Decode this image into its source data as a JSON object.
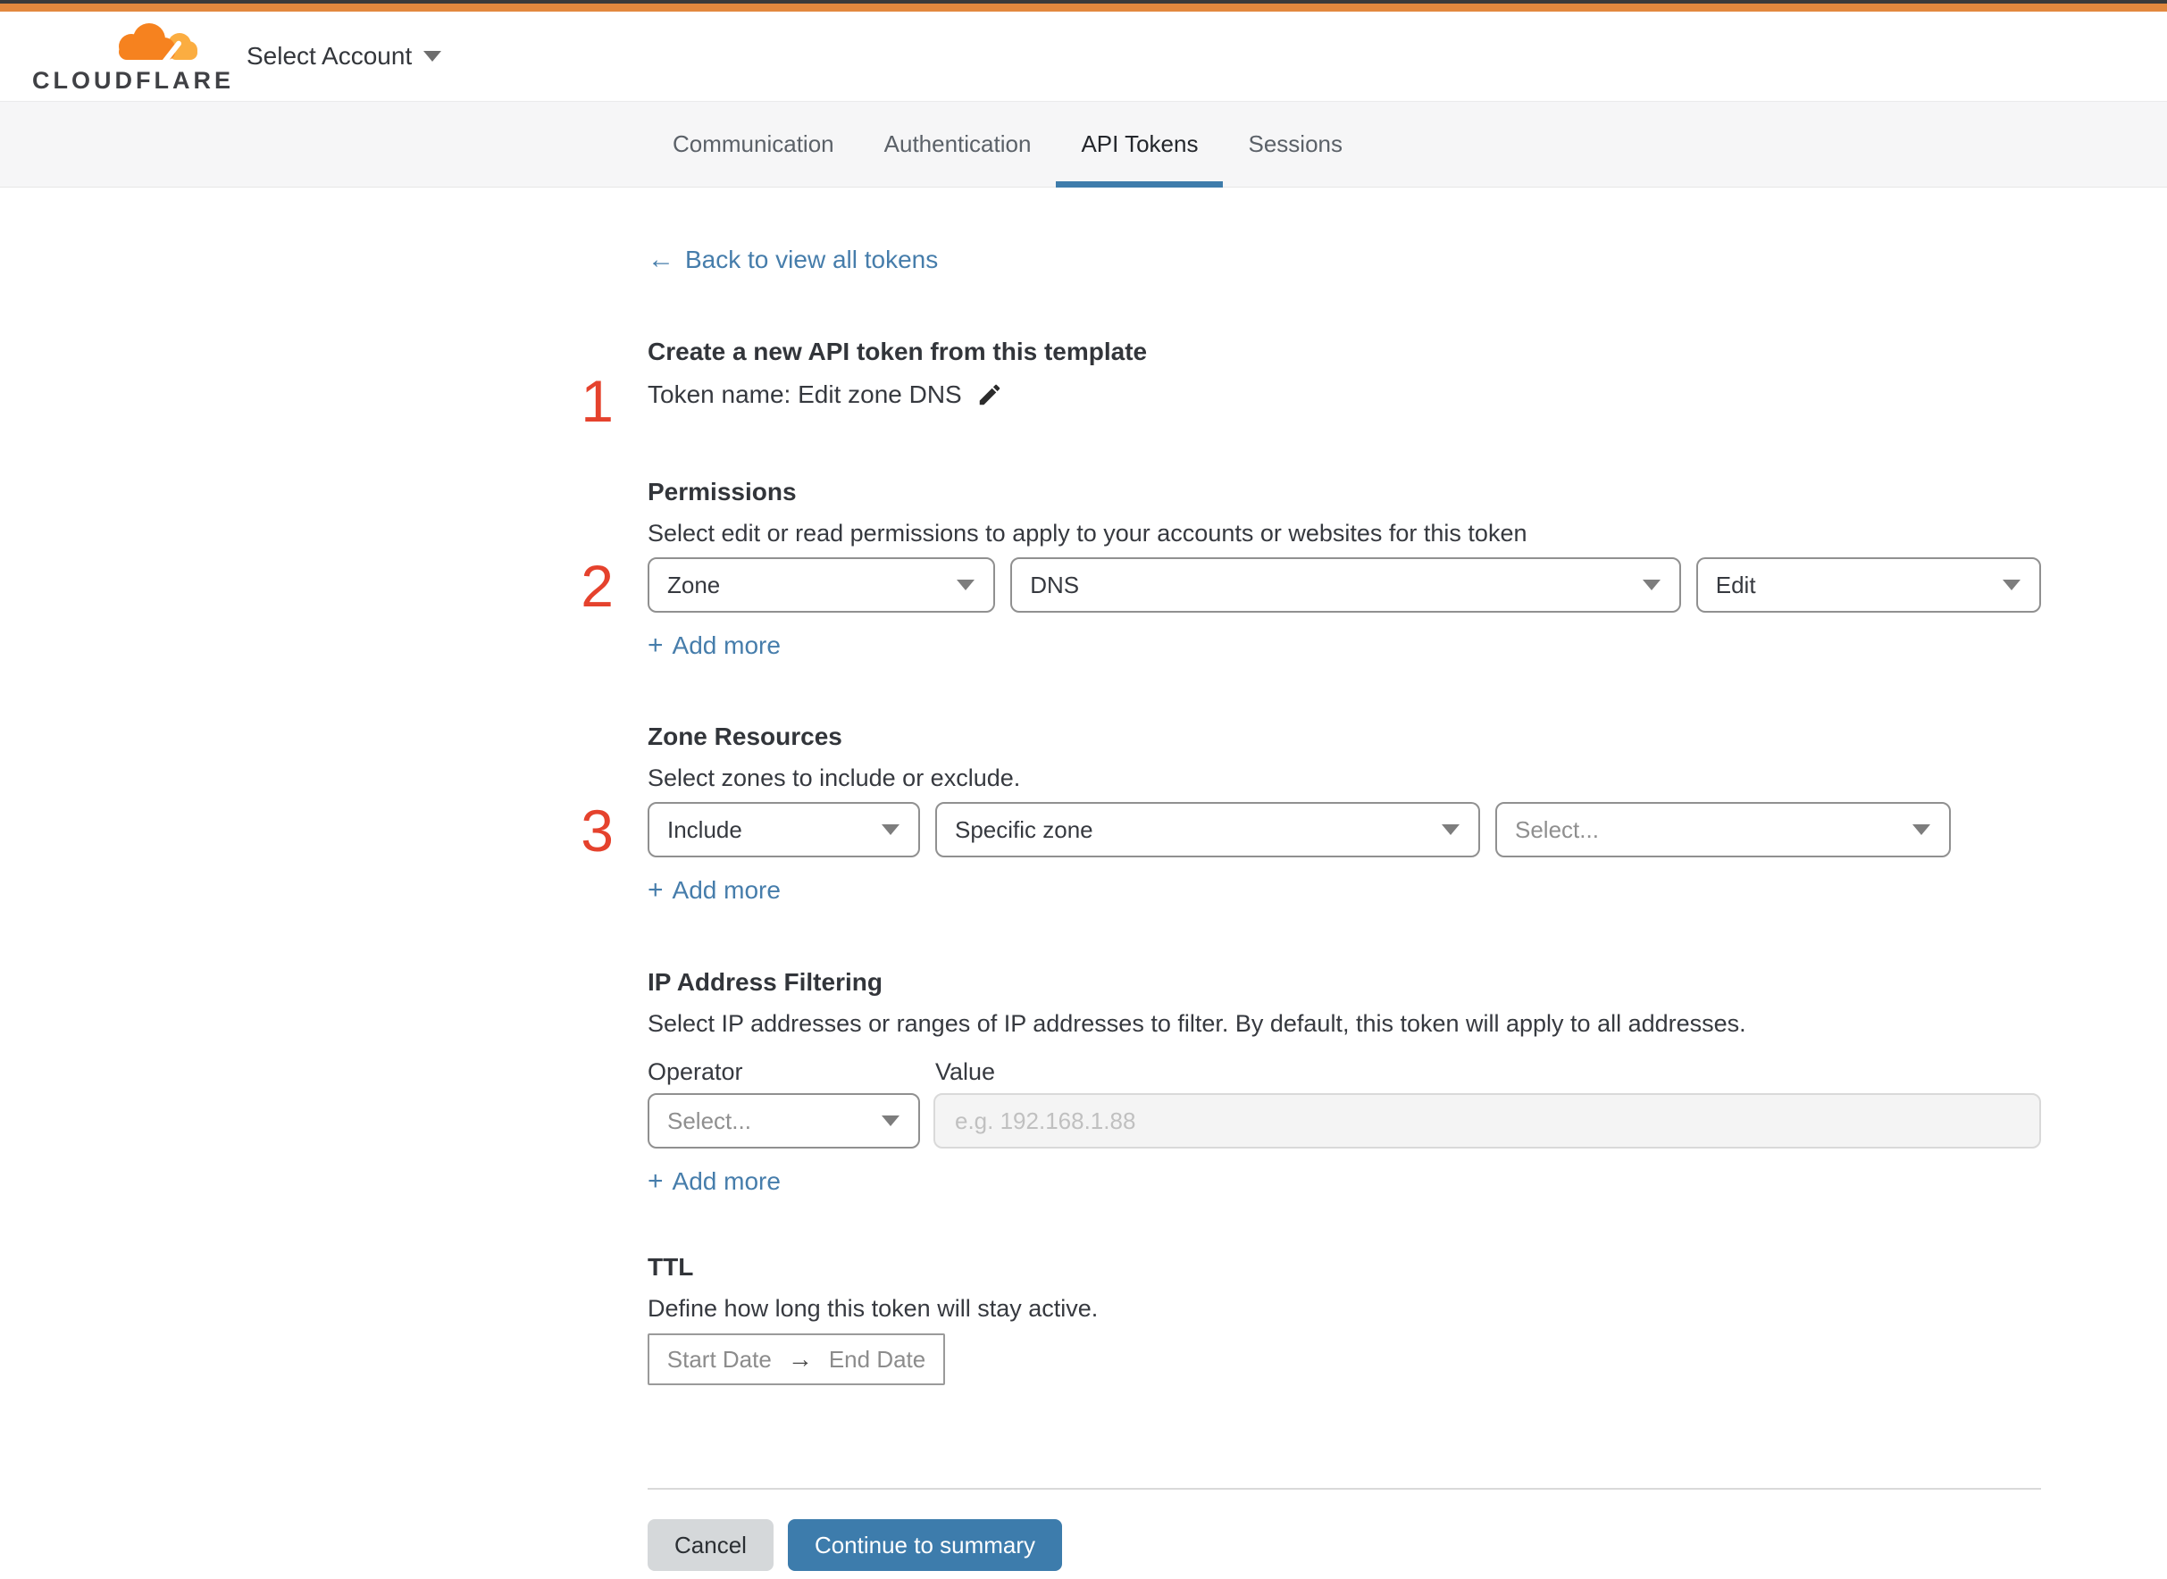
{
  "header": {
    "logo": "CLOUDFLARE",
    "account_selector": "Select Account"
  },
  "tabs": [
    {
      "label": "Communication"
    },
    {
      "label": "Authentication"
    },
    {
      "label": "API Tokens"
    },
    {
      "label": "Sessions"
    }
  ],
  "icons": {
    "back_arrow": "←",
    "plus": "+",
    "ttl_arrow": "→",
    "caret": "chevron-down",
    "pencil": "edit-pencil"
  },
  "colors": {
    "brand_orange": "#f6821f",
    "brand_orange_light": "#fbad41",
    "accent_blue": "#3d7cac",
    "marker_red": "#e5422d"
  },
  "content": {
    "back_label": "Back to view all tokens",
    "intro": {
      "marker": "1",
      "title": "Create a new API token from this template",
      "token_line": "Token name: Edit zone DNS"
    },
    "permissions": {
      "marker": "2",
      "title": "Permissions",
      "description": "Select edit or read permissions to apply to your accounts or websites for this token",
      "selects": [
        {
          "value": "Zone"
        },
        {
          "value": "DNS"
        },
        {
          "value": "Edit"
        }
      ],
      "add_more": "Add more"
    },
    "zone_resources": {
      "marker": "3",
      "title": "Zone Resources",
      "description": "Select zones to include or exclude.",
      "selects": [
        {
          "value": "Include"
        },
        {
          "value": "Specific zone"
        },
        {
          "value": "Select..."
        }
      ],
      "add_more": "Add more"
    },
    "ip_filtering": {
      "title": "IP Address Filtering",
      "description": "Select IP addresses or ranges of IP addresses to filter. By default, this token will apply to all addresses.",
      "operator_label": "Operator",
      "value_label": "Value",
      "operator_value": "Select...",
      "value_placeholder": "e.g. 192.168.1.88",
      "add_more": "Add more"
    },
    "ttl": {
      "title": "TTL",
      "description": "Define how long this token will stay active.",
      "start": "Start Date",
      "end": "End Date"
    },
    "footer": {
      "cancel": "Cancel",
      "continue_label": "Continue to summary"
    }
  }
}
